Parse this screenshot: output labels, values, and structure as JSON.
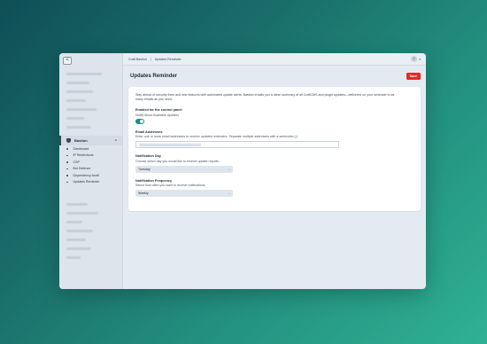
{
  "sidebar": {
    "back_icon": "<",
    "section_title": "Bastion",
    "section_chevron": "^",
    "items": [
      {
        "label": "Dashboard"
      },
      {
        "label": "IP Restrictions"
      },
      {
        "label": "CSP"
      },
      {
        "label": "Bot Defence"
      },
      {
        "label": "Dependency Audit"
      },
      {
        "label": "Updates Reminder"
      }
    ]
  },
  "topbar": {
    "crumbs": [
      "Craft Bastion",
      "Updates Reminder"
    ],
    "avatar_initial": "F",
    "caret": "▾"
  },
  "page": {
    "title": "Updates Reminder",
    "save_label": "Save"
  },
  "form": {
    "intro": "Stay ahead of security fixes and new features with automated update alerts. Bastion emails you a clean summary of all CraftCMS and plugin updates—delivered on your schedule to as many emails as you need.",
    "enabled_label": "Enabled for the control panel",
    "enabled_desc": "Notify About Available Updates",
    "email_label": "Email Addresses",
    "email_desc": "Enter one or more email addresses to receive updates reminders. Separate multiple addresses with a semicolon (;)",
    "day_label": "Notification Day",
    "day_desc": "Choose which day you would like to receive update reports.",
    "day_value": "Tuesday",
    "freq_label": "Notification Frequency",
    "freq_desc": "Select how often you want to receive notifications.",
    "freq_value": "Weekly",
    "select_arrow": "⌄"
  },
  "colors": {
    "save": "#e02a2a",
    "toggle": "#1a8f86"
  }
}
